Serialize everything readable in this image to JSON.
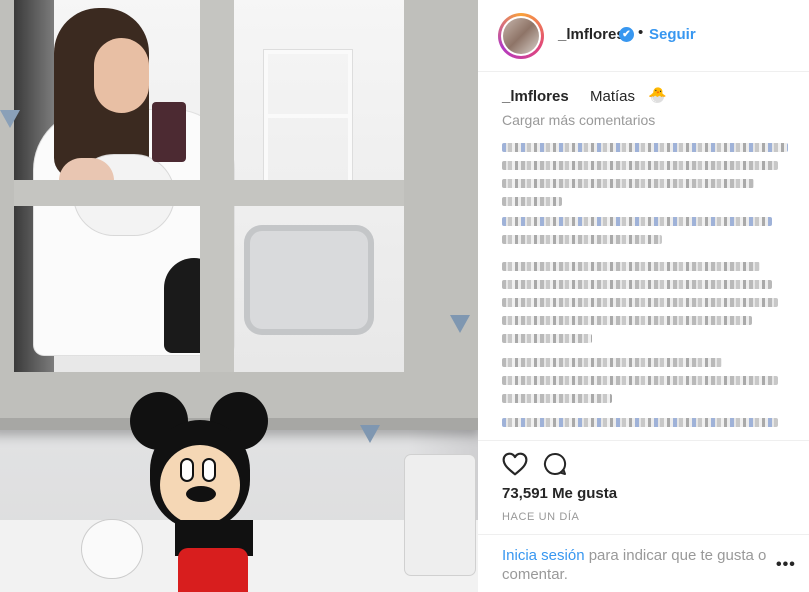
{
  "post": {
    "header": {
      "username": "_lmflores",
      "verified_mark": "✔",
      "separator": "•",
      "follow_label": "Seguir"
    },
    "caption": {
      "username": "_lmflores",
      "text": "Matías",
      "emoji": "🐣"
    },
    "load_more_label": "Cargar más comentarios",
    "likes": {
      "count": "73,591",
      "label": "Me gusta"
    },
    "time_ago": "HACE UN DÍA",
    "login_prompt": {
      "link": "Inicia sesión",
      "text": "para indicar que te gusta o comentar."
    },
    "more_options": "•••"
  },
  "icons": {
    "like": "heart-icon",
    "comment": "comment-icon",
    "verified": "verified-badge-icon"
  },
  "colors": {
    "link_blue": "#3897f0",
    "text": "#262626",
    "muted": "#999999",
    "divider": "#efefef"
  }
}
